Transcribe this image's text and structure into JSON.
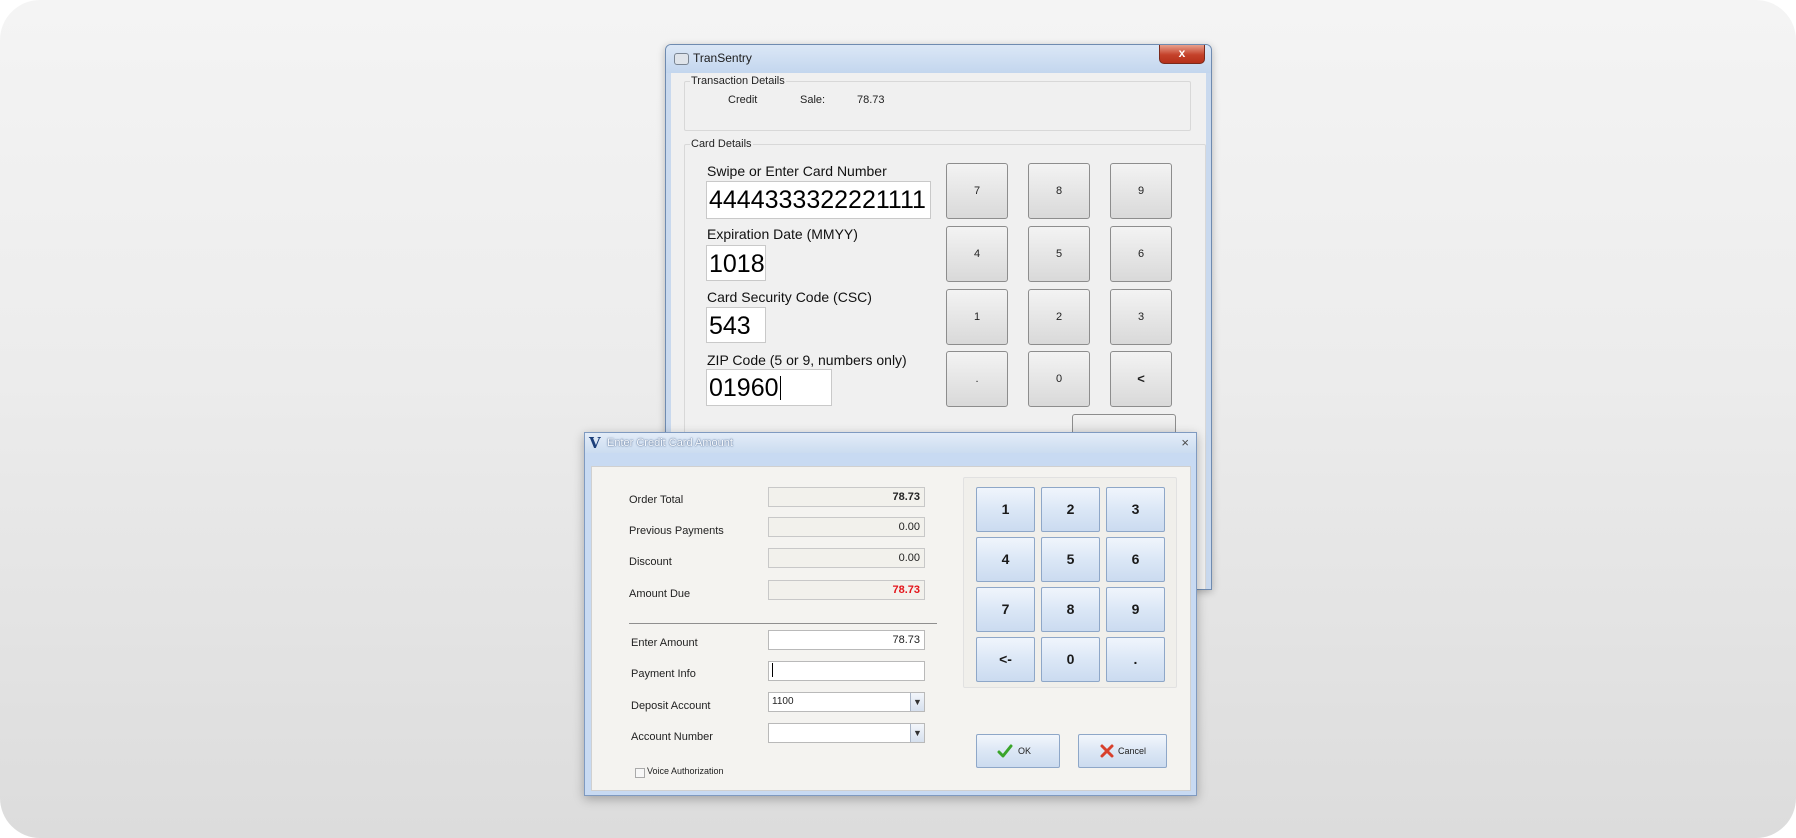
{
  "transentry": {
    "title": "TranSentry",
    "close_glyph": "x",
    "transaction_details": {
      "legend": "Transaction Details",
      "type": "Credit",
      "sale_label": "Sale:",
      "sale_amount": "78.73"
    },
    "card_details": {
      "legend": "Card Details",
      "card_number_label": "Swipe or Enter Card Number",
      "card_number_value": "4444333322221111",
      "expiration_label": "Expiration Date (MMYY)",
      "expiration_value": "1018",
      "csc_label": "Card Security Code (CSC)",
      "csc_value": "543",
      "zip_label": "ZIP Code (5 or 9, numbers only)",
      "zip_value": "01960"
    },
    "keypad": [
      "7",
      "8",
      "9",
      "4",
      "5",
      "6",
      "1",
      "2",
      "3",
      ".",
      "0",
      "<"
    ]
  },
  "amount_dialog": {
    "title": "Enter Credit Card Amount",
    "logo": "V",
    "close_glyph": "×",
    "order_total_label": "Order Total",
    "order_total_value": "78.73",
    "previous_payments_label": "Previous Payments",
    "previous_payments_value": "0.00",
    "discount_label": "Discount",
    "discount_value": "0.00",
    "amount_due_label": "Amount Due",
    "amount_due_value": "78.73",
    "enter_amount_label": "Enter Amount",
    "enter_amount_value": "78.73",
    "payment_info_label": "Payment Info",
    "payment_info_value": "",
    "deposit_account_label": "Deposit Account",
    "deposit_account_value": "1100",
    "account_number_label": "Account Number",
    "account_number_value": "",
    "voice_auth_label": "Voice Authorization",
    "keypad": [
      "1",
      "2",
      "3",
      "4",
      "5",
      "6",
      "7",
      "8",
      "9",
      "<-",
      "0",
      "."
    ],
    "ok_label": "OK",
    "cancel_label": "Cancel",
    "colors": {
      "amount_due": "#e3141a",
      "ok_check": "#3aa52a",
      "cancel_x": "#d8402c"
    }
  }
}
